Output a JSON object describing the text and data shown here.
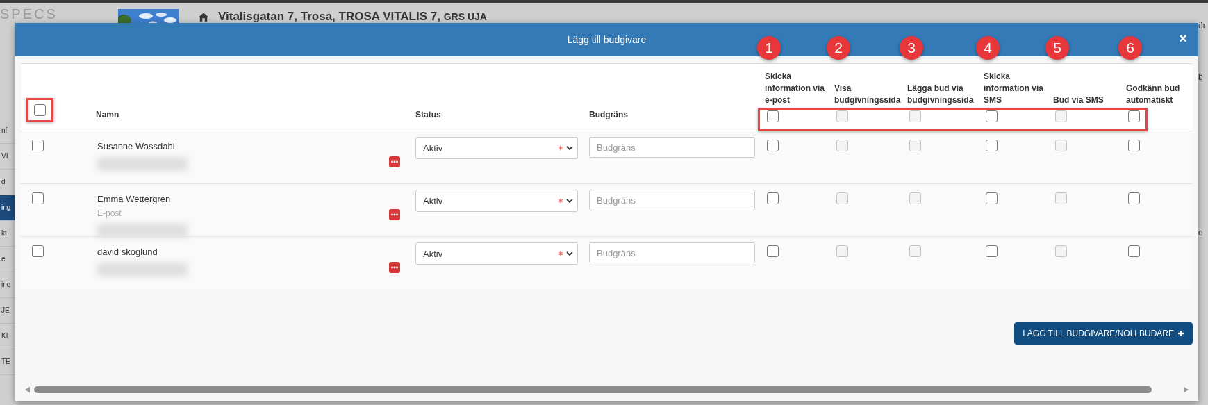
{
  "background_page": {
    "logo": "SPECS",
    "title": "Vitalisgatan 7, Trosa, TROSA VITALIS 7,",
    "title_suffix": "GRS UJA",
    "sidebar_items": [
      {
        "label": "nf",
        "selected": false
      },
      {
        "label": "VI",
        "selected": false
      },
      {
        "label": "d",
        "selected": false
      },
      {
        "label": "ing",
        "selected": true
      },
      {
        "label": "kt",
        "selected": false
      },
      {
        "label": "e",
        "selected": false
      },
      {
        "label": "ing",
        "selected": false
      },
      {
        "label": "JE",
        "selected": false
      },
      {
        "label": "KL",
        "selected": false
      },
      {
        "label": "TE",
        "selected": false
      }
    ],
    "right_fragments": [
      "ör",
      "b",
      "e"
    ]
  },
  "dialog": {
    "title": "Lägg till budgivare",
    "close": "×",
    "table": {
      "select_all": {
        "checked": false,
        "highlighted": true
      },
      "columns": {
        "name": "Namn",
        "status": "Status",
        "budget": "Budgräns"
      },
      "options_highlighted": true,
      "option_columns": [
        {
          "marker": "1",
          "label": "Skicka information via e-post",
          "disabled": false,
          "checked": false
        },
        {
          "marker": "2",
          "label": "Visa budgivningssida",
          "disabled": true,
          "checked": false
        },
        {
          "marker": "3",
          "label": "Lägga bud via budgivningssida",
          "disabled": true,
          "checked": false
        },
        {
          "marker": "4",
          "label": "Skicka information via SMS",
          "disabled": false,
          "checked": false
        },
        {
          "marker": "5",
          "label": "Bud via SMS",
          "disabled": true,
          "checked": false
        },
        {
          "marker": "6",
          "label": "Godkänn bud automatiskt",
          "disabled": false,
          "checked": false
        }
      ],
      "rows": [
        {
          "selected": false,
          "name": "Susanne Wassdahl",
          "status": "Aktiv",
          "budget_placeholder": "Budgräns",
          "options": [
            {
              "checked": false
            },
            {
              "checked": false
            },
            {
              "checked": false
            },
            {
              "checked": false
            },
            {
              "checked": false
            },
            {
              "checked": false
            }
          ]
        },
        {
          "selected": false,
          "name": "Emma Wettergren",
          "note": "E-post",
          "status": "Aktiv",
          "budget_placeholder": "Budgräns",
          "options": [
            {
              "checked": false
            },
            {
              "checked": false
            },
            {
              "checked": false
            },
            {
              "checked": false
            },
            {
              "checked": false
            },
            {
              "checked": false
            }
          ]
        },
        {
          "selected": false,
          "name": "david skoglund",
          "status": "Aktiv",
          "budget_placeholder": "Budgräns",
          "options": [
            {
              "checked": false
            },
            {
              "checked": false
            },
            {
              "checked": false
            },
            {
              "checked": false
            },
            {
              "checked": false
            },
            {
              "checked": false
            }
          ]
        }
      ]
    },
    "add_button": "LÄGG TILL BUDGIVARE/NOLLBUDARE"
  }
}
